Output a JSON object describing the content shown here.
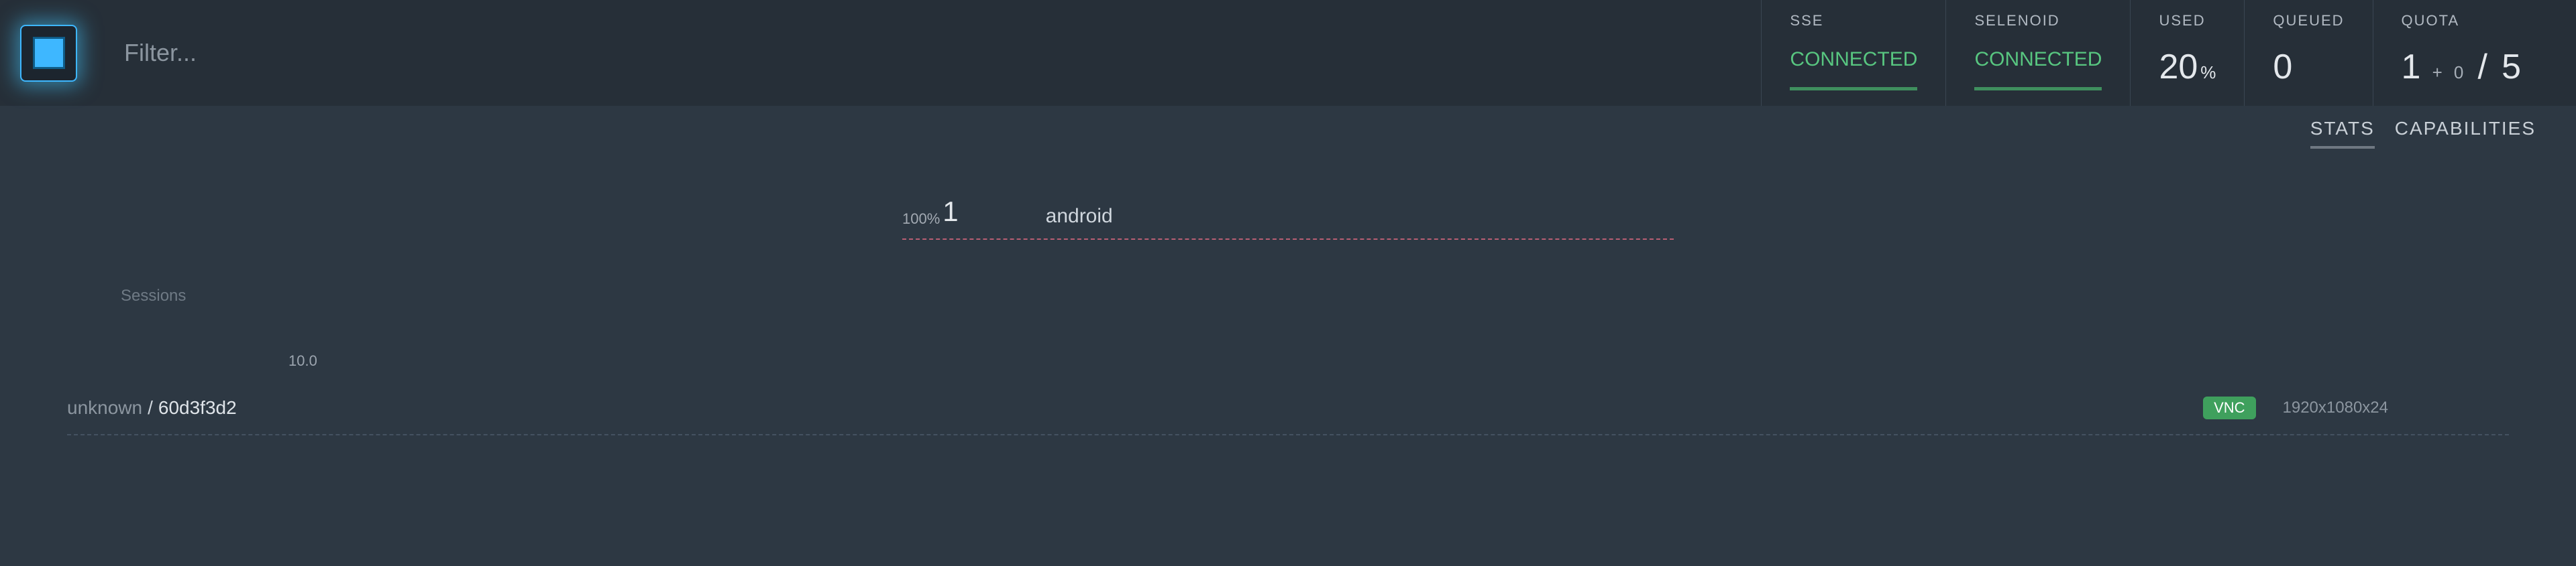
{
  "topbar": {
    "filter_placeholder": "Filter...",
    "stats": {
      "sse": {
        "label": "SSE",
        "value": "CONNECTED"
      },
      "selenoid": {
        "label": "SELENOID",
        "value": "CONNECTED"
      },
      "used": {
        "label": "USED",
        "value": "20",
        "unit": "%"
      },
      "queued": {
        "label": "QUEUED",
        "value": "0"
      },
      "quota": {
        "label": "QUOTA",
        "used": "1",
        "pending": "0",
        "total": "5"
      }
    }
  },
  "tabs": {
    "stats": "STATS",
    "capabilities": "CAPABILITIES",
    "active": "stats"
  },
  "browser_summary": {
    "percent": "100%",
    "count": "1",
    "name": "android"
  },
  "sessions": {
    "heading": "Sessions",
    "version": "10.0",
    "rows": [
      {
        "browser": "unknown",
        "separator": "/",
        "id": "60d3f3d2",
        "vnc": "VNC",
        "resolution": "1920x1080x24"
      }
    ]
  }
}
